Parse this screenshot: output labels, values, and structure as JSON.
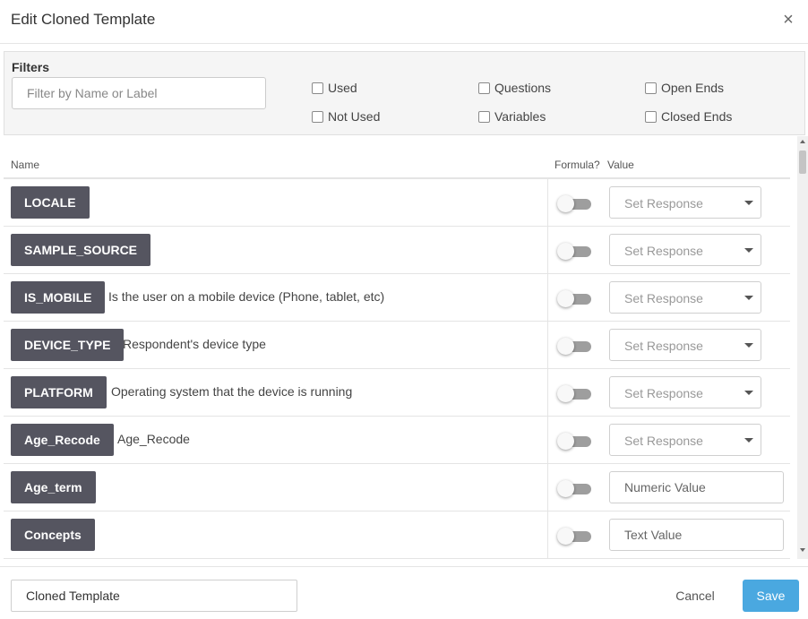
{
  "dialog": {
    "title": "Edit Cloned Template",
    "close_glyph": "×"
  },
  "filters": {
    "title": "Filters",
    "search_placeholder": "Filter by Name or Label",
    "checkboxes": [
      {
        "label": "Used",
        "checked": false
      },
      {
        "label": "Not Used",
        "checked": false
      },
      {
        "label": "Questions",
        "checked": false
      },
      {
        "label": "Variables",
        "checked": false
      },
      {
        "label": "Open Ends",
        "checked": false
      },
      {
        "label": "Closed Ends",
        "checked": false
      }
    ]
  },
  "table": {
    "headers": {
      "name": "Name",
      "formula": "Formula?",
      "value": "Value"
    },
    "rows": [
      {
        "name": "LOCALE",
        "description": "",
        "formula": false,
        "value_type": "select",
        "value_placeholder": "Set Response"
      },
      {
        "name": "SAMPLE_SOURCE",
        "description": "",
        "formula": false,
        "value_type": "select",
        "value_placeholder": "Set Response"
      },
      {
        "name": "IS_MOBILE",
        "description": "Is the user on a mobile device (Phone, tablet, etc)",
        "formula": false,
        "value_type": "select",
        "value_placeholder": "Set Response"
      },
      {
        "name": "DEVICE_TYPE",
        "description": "Respondent's device type",
        "formula": false,
        "value_type": "select",
        "value_placeholder": "Set Response"
      },
      {
        "name": "PLATFORM",
        "description": "Operating system that the device is running",
        "formula": false,
        "value_type": "select",
        "value_placeholder": "Set Response"
      },
      {
        "name": "Age_Recode",
        "description": "Age_Recode",
        "formula": false,
        "value_type": "select",
        "value_placeholder": "Set Response"
      },
      {
        "name": "Age_term",
        "description": "",
        "formula": false,
        "value_type": "input",
        "value_placeholder": "Numeric Value"
      },
      {
        "name": "Concepts",
        "description": "",
        "formula": false,
        "value_type": "input",
        "value_placeholder": "Text Value"
      }
    ]
  },
  "footer": {
    "template_name_value": "Cloned Template",
    "cancel_label": "Cancel",
    "save_label": "Save"
  },
  "colors": {
    "tag_background": "#555560",
    "save_button": "#4aa8e0",
    "toggle_track": "#9e9e9e"
  }
}
